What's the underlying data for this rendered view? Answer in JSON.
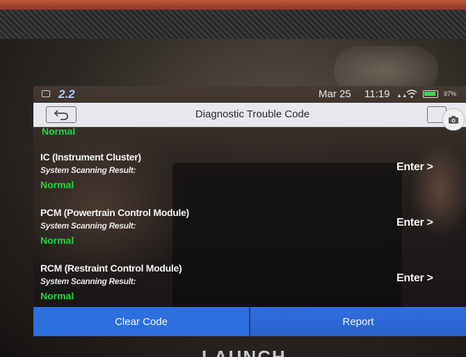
{
  "device": {
    "brand_text": "LAUNCH"
  },
  "status_bar": {
    "left_number": "2.2",
    "date": "Mar 25",
    "time": "11:19",
    "battery_percent": "97%",
    "battery_level": 0.97,
    "icons": [
      "photo-icon",
      "signal-icon",
      "wifi-icon",
      "battery-icon"
    ]
  },
  "header": {
    "title": "Diagnostic Trouble Code",
    "icons": [
      "back-arrow-icon",
      "camera-icon"
    ]
  },
  "modules": {
    "partial_status": "Normal",
    "items": [
      {
        "name": "IC (Instrument Cluster)",
        "subtitle": "System Scanning Result:",
        "status": "Normal",
        "action": "Enter >"
      },
      {
        "name": "PCM (Powertrain Control Module)",
        "subtitle": "System Scanning Result:",
        "status": "Normal",
        "action": "Enter >"
      },
      {
        "name": "RCM (Restraint Control Module)",
        "subtitle": "System Scanning Result:",
        "status": "Normal",
        "action": "Enter >"
      }
    ]
  },
  "footer": {
    "clear_label": "Clear Code",
    "report_label": "Report"
  },
  "colors": {
    "status_normal": "#22d63a",
    "button_blue": "#2d6fe0",
    "title_bar": "#e6e8ee"
  }
}
